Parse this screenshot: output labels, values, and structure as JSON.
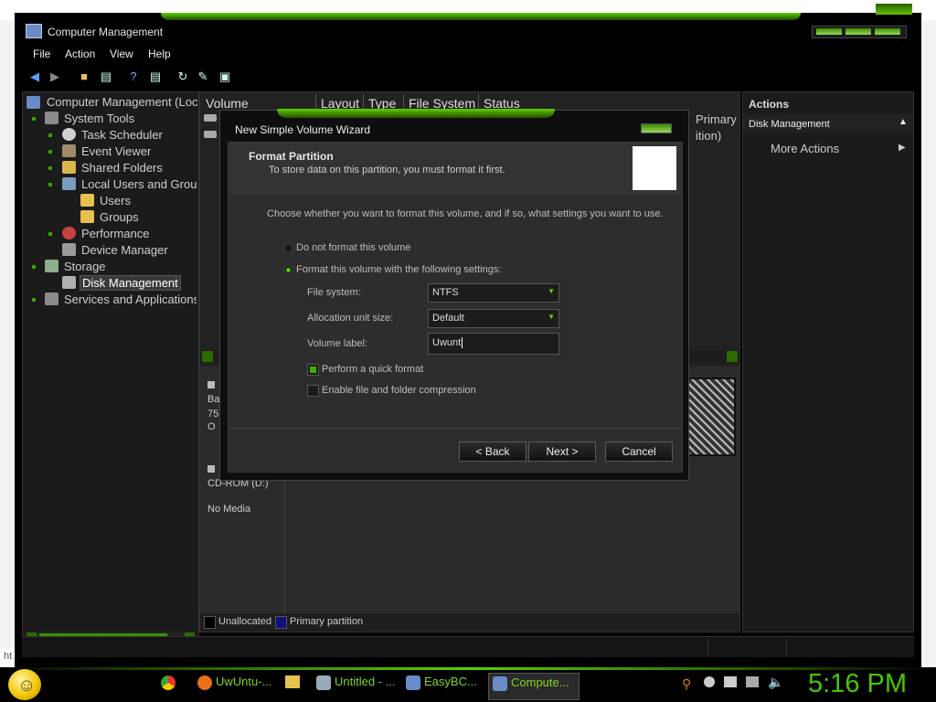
{
  "window": {
    "title": "Computer Management"
  },
  "menu": [
    "File",
    "Action",
    "View",
    "Help"
  ],
  "tree": {
    "root": "Computer Management (Loc",
    "system_tools": "System Tools",
    "task_scheduler": "Task Scheduler",
    "event_viewer": "Event Viewer",
    "shared_folders": "Shared Folders",
    "local_users": "Local Users and Grou",
    "users": "Users",
    "groups": "Groups",
    "performance": "Performance",
    "device_manager": "Device Manager",
    "storage": "Storage",
    "disk_management": "Disk Management",
    "services": "Services and Applications"
  },
  "columns": [
    "Volume",
    "Layout",
    "Type",
    "File System",
    "Status"
  ],
  "center_overflow": {
    "primary": "Primary",
    "ition": "ition)"
  },
  "disk_panel": {
    "partial_b": "Ba",
    "partial_7": "75",
    "partial_o": "O",
    "cdrom": "CD-ROM (D:)",
    "no_media": "No Media"
  },
  "legend": {
    "unallocated": "Unallocated",
    "primary": "Primary partition"
  },
  "actions": {
    "header": "Actions",
    "section": "Disk Management",
    "more": "More Actions"
  },
  "dialog": {
    "title": "New Simple Volume Wizard",
    "head_title": "Format Partition",
    "head_sub": "To store data on this partition, you must format it first.",
    "instruction": "Choose whether you want to format this volume, and if so, what settings you want to use.",
    "opt_no_format": "Do not format this volume",
    "opt_format": "Format this volume with the following settings:",
    "fs_label": "File system:",
    "fs_value": "NTFS",
    "alloc_label": "Allocation unit size:",
    "alloc_value": "Default",
    "vol_label": "Volume label:",
    "vol_value": "Uwunt",
    "quick_format": "Perform a quick format",
    "compression": "Enable file and folder compression",
    "back": "< Back",
    "next": "Next >",
    "cancel": "Cancel"
  },
  "taskbar": {
    "tasks": [
      "UwUntu-...",
      "Untitled - ...",
      "EasyBC...",
      "Compute..."
    ],
    "clock": "5:16 PM"
  },
  "url_hint": "ht",
  "colors": {
    "accent": "#46c800",
    "background": "#000000"
  }
}
